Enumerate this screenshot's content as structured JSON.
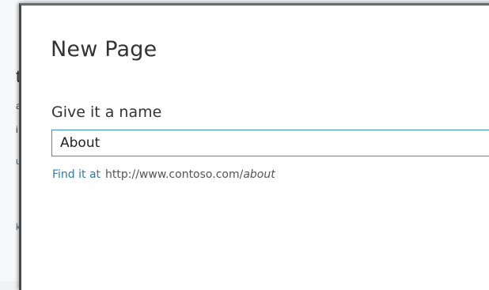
{
  "background": {
    "fragments": [
      "t",
      "a",
      "i",
      "u",
      "k"
    ]
  },
  "dialog": {
    "title": "New Page",
    "name_label": "Give it a name",
    "name_value": "About",
    "url_prefix_label": "Find it at",
    "url_base": "http://www.contoso.com/",
    "url_slug": "about"
  },
  "colors": {
    "accent": "#3b8fd6",
    "link": "#2a7ab8",
    "text": "#333333"
  }
}
